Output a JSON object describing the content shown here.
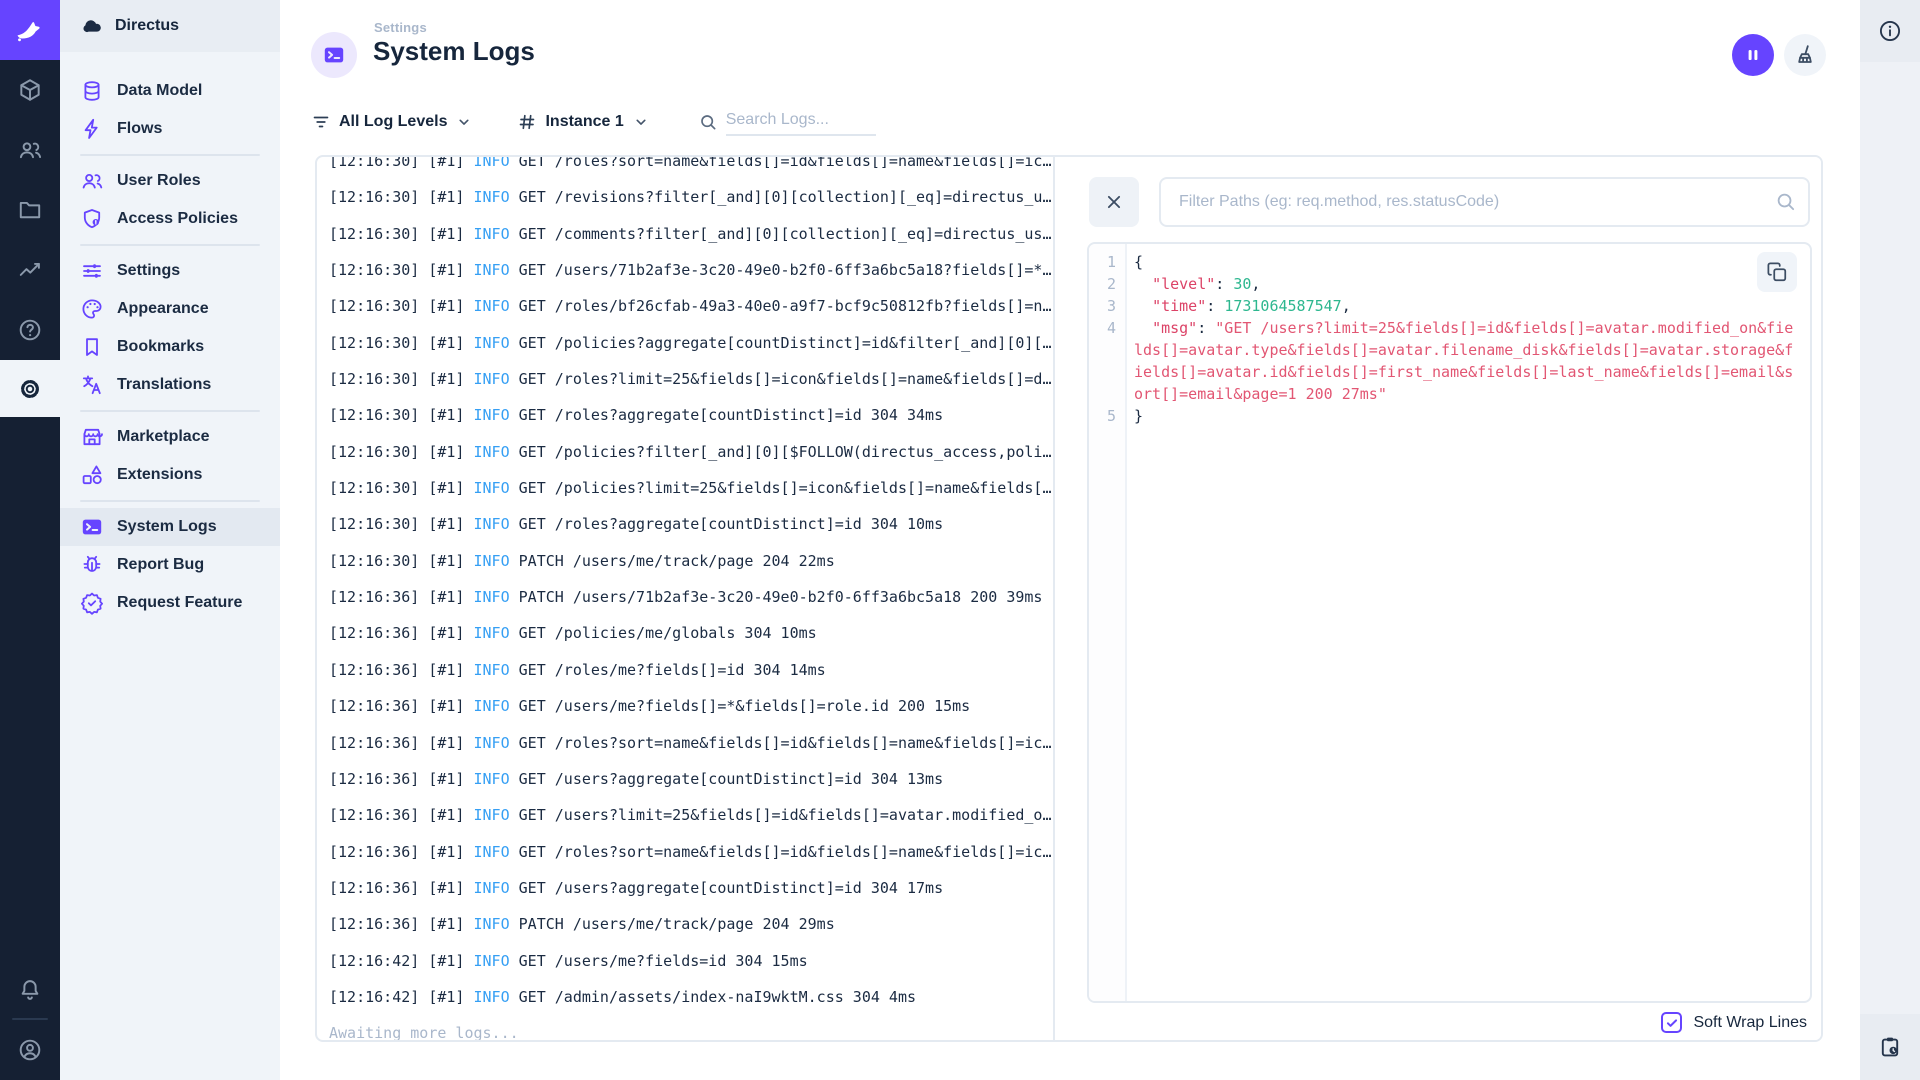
{
  "colors": {
    "accent": "#6644ff",
    "module_bar_bg": "#152033",
    "nav_bg": "#f0f4f9",
    "info_level_blue": "#359ff4",
    "json_key": "#dc4367",
    "json_number": "#2db78f",
    "json_string": "#e25673",
    "muted_text": "#a9b7cb"
  },
  "module_bar": {
    "items": [
      {
        "icon": "box"
      },
      {
        "icon": "users"
      },
      {
        "icon": "folder"
      },
      {
        "icon": "activity"
      },
      {
        "icon": "help"
      },
      {
        "icon": "gear",
        "active": true
      }
    ],
    "bottom": [
      {
        "icon": "bell"
      },
      {
        "icon": "person-circle"
      }
    ]
  },
  "nav": {
    "project_name": "Directus",
    "items": [
      {
        "label": "Data Model",
        "icon": "database"
      },
      {
        "label": "Flows",
        "icon": "bolt"
      },
      {
        "divider": true
      },
      {
        "label": "User Roles",
        "icon": "users"
      },
      {
        "label": "Access Policies",
        "icon": "shield"
      },
      {
        "divider": true
      },
      {
        "label": "Settings",
        "icon": "tune"
      },
      {
        "label": "Appearance",
        "icon": "palette"
      },
      {
        "label": "Bookmarks",
        "icon": "bookmark"
      },
      {
        "label": "Translations",
        "icon": "translate"
      },
      {
        "divider": true
      },
      {
        "label": "Marketplace",
        "icon": "storefront"
      },
      {
        "label": "Extensions",
        "icon": "extension"
      },
      {
        "divider": true
      },
      {
        "label": "System Logs",
        "icon": "terminal",
        "active": true
      },
      {
        "label": "Report Bug",
        "icon": "bug"
      },
      {
        "label": "Request Feature",
        "icon": "verified"
      }
    ]
  },
  "header": {
    "breadcrumb": "Settings",
    "title": "System Logs"
  },
  "toolbar": {
    "log_level_filter": "All Log Levels",
    "instance_filter": "Instance 1",
    "search_placeholder": "Search Logs..."
  },
  "logs": {
    "awaiting": "Awaiting more logs...",
    "rows": [
      {
        "time": "[12:16:30]",
        "inst": "[#1]",
        "level": "INFO",
        "msg": "GET /roles?sort=name&fields[]=id&fields[]=name&fields[]=ic…"
      },
      {
        "time": "[12:16:30]",
        "inst": "[#1]",
        "level": "INFO",
        "msg": "GET /revisions?filter[_and][0][collection][_eq]=directus_u…"
      },
      {
        "time": "[12:16:30]",
        "inst": "[#1]",
        "level": "INFO",
        "msg": "GET /comments?filter[_and][0][collection][_eq]=directus_us…"
      },
      {
        "time": "[12:16:30]",
        "inst": "[#1]",
        "level": "INFO",
        "msg": "GET /users/71b2af3e-3c20-49e0-b2f0-6ff3a6bc5a18?fields[]=*…"
      },
      {
        "time": "[12:16:30]",
        "inst": "[#1]",
        "level": "INFO",
        "msg": "GET /roles/bf26cfab-49a3-40e0-a9f7-bcf9c50812fb?fields[]=n…"
      },
      {
        "time": "[12:16:30]",
        "inst": "[#1]",
        "level": "INFO",
        "msg": "GET /policies?aggregate[countDistinct]=id&filter[_and][0][…"
      },
      {
        "time": "[12:16:30]",
        "inst": "[#1]",
        "level": "INFO",
        "msg": "GET /roles?limit=25&fields[]=icon&fields[]=name&fields[]=d…"
      },
      {
        "time": "[12:16:30]",
        "inst": "[#1]",
        "level": "INFO",
        "msg": "GET /roles?aggregate[countDistinct]=id 304 34ms"
      },
      {
        "time": "[12:16:30]",
        "inst": "[#1]",
        "level": "INFO",
        "msg": "GET /policies?filter[_and][0][$FOLLOW(directus_access,poli…"
      },
      {
        "time": "[12:16:30]",
        "inst": "[#1]",
        "level": "INFO",
        "msg": "GET /policies?limit=25&fields[]=icon&fields[]=name&fields[…"
      },
      {
        "time": "[12:16:30]",
        "inst": "[#1]",
        "level": "INFO",
        "msg": "GET /roles?aggregate[countDistinct]=id 304 10ms"
      },
      {
        "time": "[12:16:30]",
        "inst": "[#1]",
        "level": "INFO",
        "msg": "PATCH /users/me/track/page 204 22ms"
      },
      {
        "time": "[12:16:36]",
        "inst": "[#1]",
        "level": "INFO",
        "msg": "PATCH /users/71b2af3e-3c20-49e0-b2f0-6ff3a6bc5a18 200 39ms"
      },
      {
        "time": "[12:16:36]",
        "inst": "[#1]",
        "level": "INFO",
        "msg": "GET /policies/me/globals 304 10ms"
      },
      {
        "time": "[12:16:36]",
        "inst": "[#1]",
        "level": "INFO",
        "msg": "GET /roles/me?fields[]=id 304 14ms"
      },
      {
        "time": "[12:16:36]",
        "inst": "[#1]",
        "level": "INFO",
        "msg": "GET /users/me?fields[]=*&fields[]=role.id 200 15ms"
      },
      {
        "time": "[12:16:36]",
        "inst": "[#1]",
        "level": "INFO",
        "msg": "GET /roles?sort=name&fields[]=id&fields[]=name&fields[]=ic…"
      },
      {
        "time": "[12:16:36]",
        "inst": "[#1]",
        "level": "INFO",
        "msg": "GET /users?aggregate[countDistinct]=id 304 13ms"
      },
      {
        "time": "[12:16:36]",
        "inst": "[#1]",
        "level": "INFO",
        "msg": "GET /users?limit=25&fields[]=id&fields[]=avatar.modified_o…"
      },
      {
        "time": "[12:16:36]",
        "inst": "[#1]",
        "level": "INFO",
        "msg": "GET /roles?sort=name&fields[]=id&fields[]=name&fields[]=ic…"
      },
      {
        "time": "[12:16:36]",
        "inst": "[#1]",
        "level": "INFO",
        "msg": "GET /users?aggregate[countDistinct]=id 304 17ms"
      },
      {
        "time": "[12:16:36]",
        "inst": "[#1]",
        "level": "INFO",
        "msg": "PATCH /users/me/track/page 204 29ms"
      },
      {
        "time": "[12:16:42]",
        "inst": "[#1]",
        "level": "INFO",
        "msg": "GET /users/me?fields=id 304 15ms"
      },
      {
        "time": "[12:16:42]",
        "inst": "[#1]",
        "level": "INFO",
        "msg": "GET /admin/assets/index-naI9wktM.css 304 4ms"
      }
    ]
  },
  "detail": {
    "filter_placeholder": "Filter Paths (eg: req.method, res.statusCode)",
    "soft_wrap_label": "Soft Wrap Lines",
    "soft_wrap_checked": true,
    "code": {
      "lines": [
        {
          "num": "1",
          "tokens": [
            {
              "text": "{",
              "type": "punct"
            }
          ]
        },
        {
          "num": "2",
          "tokens": [
            {
              "text": "  ",
              "type": "punct"
            },
            {
              "text": "\"level\"",
              "type": "key"
            },
            {
              "text": ": ",
              "type": "punct"
            },
            {
              "text": "30",
              "type": "number"
            },
            {
              "text": ",",
              "type": "punct"
            }
          ]
        },
        {
          "num": "3",
          "tokens": [
            {
              "text": "  ",
              "type": "punct"
            },
            {
              "text": "\"time\"",
              "type": "key"
            },
            {
              "text": ": ",
              "type": "punct"
            },
            {
              "text": "1731064587547",
              "type": "number"
            },
            {
              "text": ",",
              "type": "punct"
            }
          ]
        },
        {
          "num": "4",
          "tokens": [
            {
              "text": "  ",
              "type": "punct"
            },
            {
              "text": "\"msg\"",
              "type": "key"
            },
            {
              "text": ": ",
              "type": "punct"
            },
            {
              "text": "\"GET /users?limit=25&fields[]=id&fields[]=avatar.modified_on&fields[]=avatar.type&fields[]=avatar.filename_disk&fields[]=avatar.storage&fields[]=avatar.id&fields[]=first_name&fields[]=last_name&fields[]=email&sort[]=email&page=1 200 27ms\"",
              "type": "string"
            }
          ]
        },
        {
          "num": "5",
          "tokens": [
            {
              "text": "}",
              "type": "punct"
            }
          ]
        }
      ]
    }
  }
}
